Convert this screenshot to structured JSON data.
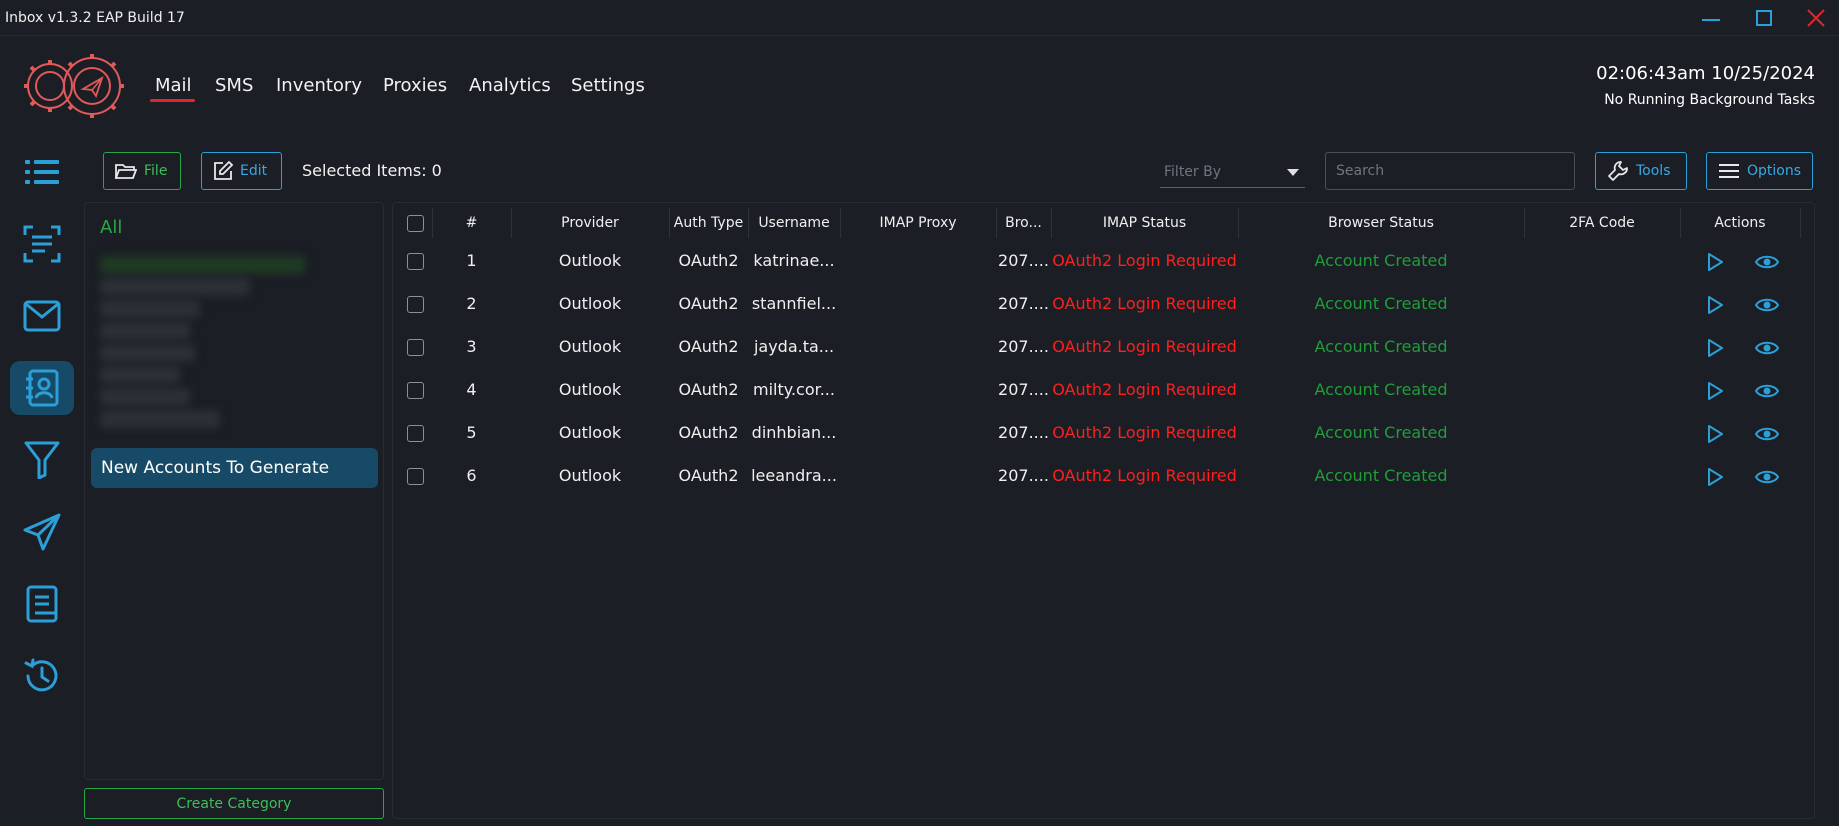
{
  "app": {
    "title": "Inbox v1.3.2 EAP Build 17"
  },
  "nav": {
    "tabs": [
      {
        "label": "Mail",
        "active": true
      },
      {
        "label": "SMS"
      },
      {
        "label": "Inventory"
      },
      {
        "label": "Proxies"
      },
      {
        "label": "Analytics"
      },
      {
        "label": "Settings"
      }
    ]
  },
  "status": {
    "clock": "02:06:43am 10/25/2024",
    "background_tasks": "No Running Background Tasks"
  },
  "rail": {
    "icons": [
      "list-icon",
      "scan-text-icon",
      "mail-icon",
      "contacts-book-icon",
      "filter-icon",
      "send-icon",
      "book-icon",
      "history-icon"
    ],
    "active_icon": "contacts-book-icon"
  },
  "toolbar": {
    "file_label": "File",
    "edit_label": "Edit",
    "selected_items": "Selected Items: 0",
    "filter_placeholder": "Filter By",
    "search_placeholder": "Search",
    "tools_label": "Tools",
    "options_label": "Options"
  },
  "categories": {
    "all_label": "All",
    "selected_label": "New Accounts To Generate",
    "create_label": "Create Category"
  },
  "table": {
    "headers": [
      "#",
      "Provider",
      "Auth Type",
      "Username",
      "IMAP Proxy",
      "Bro...",
      "IMAP Status",
      "Browser Status",
      "2FA Code",
      "Actions"
    ],
    "rows": [
      {
        "num": "1",
        "provider": "Outlook",
        "auth": "OAuth2",
        "username": "katrinae...",
        "imap_proxy": "",
        "browser": "207....",
        "imap_status": "OAuth2 Login Required",
        "browser_status": "Account Created",
        "twofa": ""
      },
      {
        "num": "2",
        "provider": "Outlook",
        "auth": "OAuth2",
        "username": "stannfiel...",
        "imap_proxy": "",
        "browser": "207....",
        "imap_status": "OAuth2 Login Required",
        "browser_status": "Account Created",
        "twofa": ""
      },
      {
        "num": "3",
        "provider": "Outlook",
        "auth": "OAuth2",
        "username": "jayda.ta...",
        "imap_proxy": "",
        "browser": "207....",
        "imap_status": "OAuth2 Login Required",
        "browser_status": "Account Created",
        "twofa": ""
      },
      {
        "num": "4",
        "provider": "Outlook",
        "auth": "OAuth2",
        "username": "milty.cor...",
        "imap_proxy": "",
        "browser": "207....",
        "imap_status": "OAuth2 Login Required",
        "browser_status": "Account Created",
        "twofa": ""
      },
      {
        "num": "5",
        "provider": "Outlook",
        "auth": "OAuth2",
        "username": "dinhbian...",
        "imap_proxy": "",
        "browser": "207....",
        "imap_status": "OAuth2 Login Required",
        "browser_status": "Account Created",
        "twofa": ""
      },
      {
        "num": "6",
        "provider": "Outlook",
        "auth": "OAuth2",
        "username": "leeandra...",
        "imap_proxy": "",
        "browser": "207....",
        "imap_status": "OAuth2 Login Required",
        "browser_status": "Account Created",
        "twofa": ""
      }
    ],
    "row_actions": [
      "play-icon",
      "eye-icon"
    ]
  },
  "colors": {
    "accent_blue": "#2b9fd8",
    "accent_green": "#28a745",
    "error_red": "#ff1f1f",
    "nav_underline": "#e0262b",
    "selected_bg": "#174a66",
    "background": "#1b1e24"
  }
}
